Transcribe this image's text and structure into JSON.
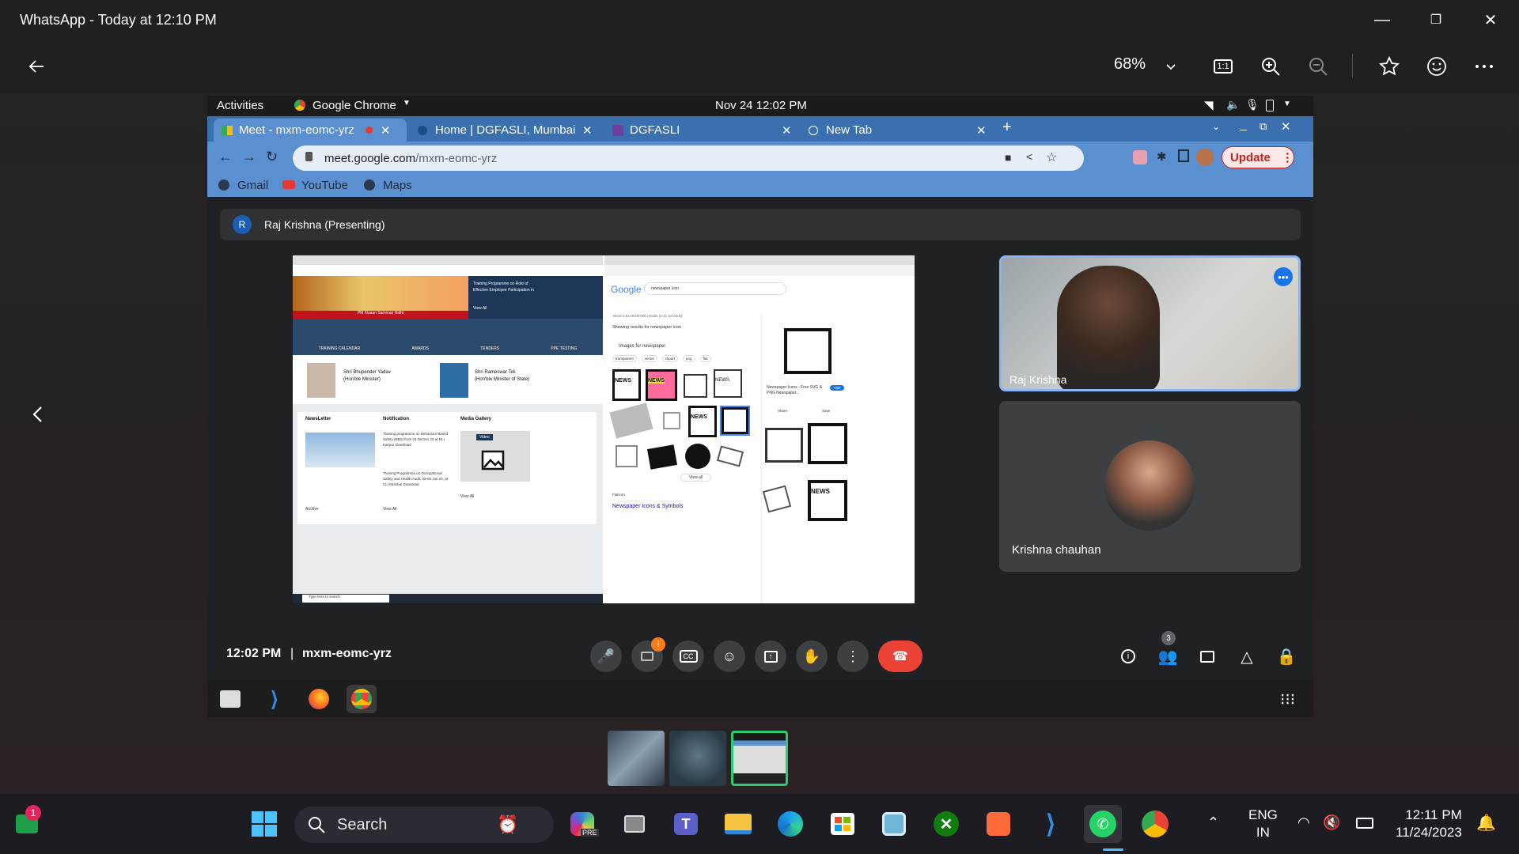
{
  "window": {
    "title": "WhatsApp - Today at 12:10 PM",
    "minimize": "—",
    "maximize": "❐",
    "close": "✕"
  },
  "toolbar": {
    "zoom": "68%",
    "zoom_dropdown_icon": "chevron-down-icon",
    "actual_size_label": "1:1"
  },
  "shot": {
    "ubuntu": {
      "activities": "Activities",
      "app": "Google Chrome",
      "datetime": "Nov 24  12:02 PM"
    },
    "tabs": [
      {
        "label": "Meet - mxm-eomc-yrz"
      },
      {
        "label": "Home | DGFASLI, Mumbai"
      },
      {
        "label": "DGFASLI"
      },
      {
        "label": "New Tab"
      }
    ],
    "url_host": "meet.google.com",
    "url_path": "/mxm-eomc-yrz",
    "update_label": "Update",
    "bookmarks": [
      "Gmail",
      "YouTube",
      "Maps"
    ],
    "presenting": {
      "initial": "R",
      "label": "Raj Krishna (Presenting)"
    },
    "participants": [
      {
        "name": "Raj Krishna"
      },
      {
        "name": "Krishna chauhan"
      }
    ],
    "meeting": {
      "time": "12:02 PM",
      "separator": "|",
      "code": "mxm-eomc-yrz",
      "people_count": "3",
      "camera_alert": "!"
    },
    "shared_screen": {
      "left": {
        "menu": [
          "TRAINING CALENDAR",
          "AWARDS",
          "TENDERS",
          "PPE TESTING"
        ],
        "banner_caption": "PM Kisaan Samman Nidhi",
        "banner_text": "Training Programme on Role of Effective Employee Participation in",
        "view_all": "View All",
        "ministers": [
          {
            "name": "Shri Bhupender Yadav",
            "role": "(Hon'ble Minister)"
          },
          {
            "name": "Shri Rameswar Teli",
            "role": "(Hon'ble Minister of State)"
          }
        ],
        "sections": [
          "NewsLetter",
          "Notification",
          "Media Gallery"
        ],
        "notif1": "Training programme on Behaviour Based Safety (BBS) from 04-08 Dec 23 at RLI Kanpur Download",
        "notif2": "Training Programme on Occupational Safety and Health Audit, 03-05 Jan 24, at CLI Mumbai Download",
        "archive": "Archive",
        "video": "Video",
        "search_placeholder": "Type here to search"
      },
      "right": {
        "google": "Google",
        "query": "newspaper icon",
        "results_stats": "About 4,81,00,00,000 results (0.41 seconds)",
        "showing": "Showing results for newspaper icon",
        "images_for": "Images for newspaper",
        "chips": [
          "transparent",
          "vector",
          "clipart",
          "png",
          "flat"
        ],
        "side_title": "Newspaper Icons - Free SVG & PNG Newspaper...",
        "side_visit": "Visit",
        "side_share": "Share",
        "side_save": "Save",
        "result_title": "Newspaper Icons & Symbols",
        "result_site": "Flaticon",
        "view_all": "View all",
        "news_words": [
          "NEWS",
          "NEWS",
          "NEWS",
          "NEWS",
          "NEWS"
        ]
      }
    }
  },
  "taskbar": {
    "search": "Search",
    "lang1": "ENG",
    "lang2": "IN",
    "time": "12:11 PM",
    "date": "11/24/2023",
    "whatsapp_badge": "1",
    "pre_badge": "PRE"
  }
}
